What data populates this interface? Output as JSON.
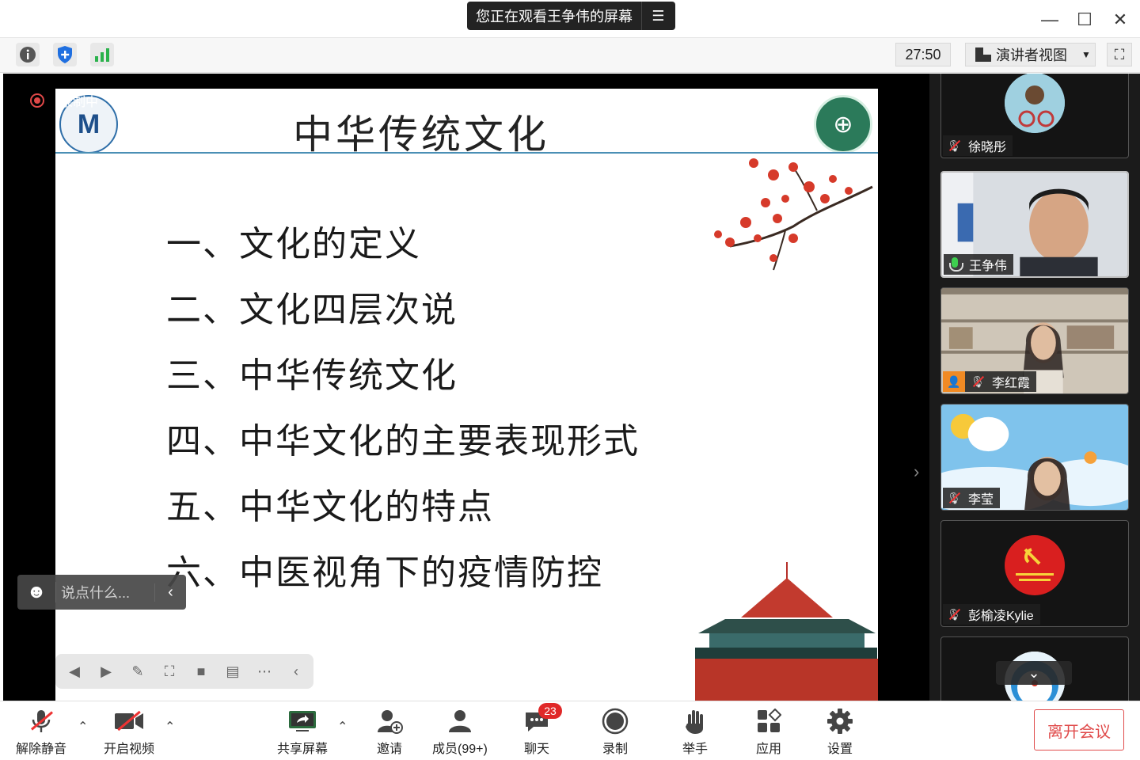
{
  "titlebar": {
    "share_banner": "您正在观看王争伟的屏幕",
    "menu_glyph": "☰",
    "minimize": "—",
    "maximize": "☐",
    "close": "✕"
  },
  "toolbar": {
    "info_icon": "info-icon",
    "shield_icon": "shield-icon",
    "signal_icon": "signal-icon",
    "timer": "27:50",
    "view_label": "演讲者视图",
    "fullscreen_icon": "fullscreen-icon"
  },
  "stage": {
    "recording_label": "录制中",
    "slide": {
      "title": "中华传统文化",
      "items": [
        "一、文化的定义",
        "二、文化四层次说",
        "三、中华传统文化",
        "四、中华文化的主要表现形式",
        "五、中华文化的特点",
        "六、中医视角下的疫情防控"
      ]
    },
    "chat_placeholder": "说点什么..."
  },
  "gallery": {
    "participants": [
      {
        "name": "徐晓彤",
        "mic": "muted"
      },
      {
        "name": "王争伟",
        "mic": "on"
      },
      {
        "name": "李红霞",
        "mic": "muted"
      },
      {
        "name": "李莹",
        "mic": "muted"
      },
      {
        "name": "彭榆凌Kylie",
        "mic": "muted"
      }
    ]
  },
  "controls": {
    "unmute": "解除静音",
    "start_video": "开启视频",
    "share_screen": "共享屏幕",
    "invite": "邀请",
    "members": "成员(99+)",
    "chat": "聊天",
    "chat_badge": "23",
    "record": "录制",
    "raise_hand": "举手",
    "apps": "应用",
    "settings": "设置",
    "leave": "离开会议"
  },
  "colors": {
    "leave_red": "#e04b4b",
    "badge_red": "#e02828",
    "slide_rule": "#4a8fb5",
    "mic_green": "#3ecf4f"
  }
}
